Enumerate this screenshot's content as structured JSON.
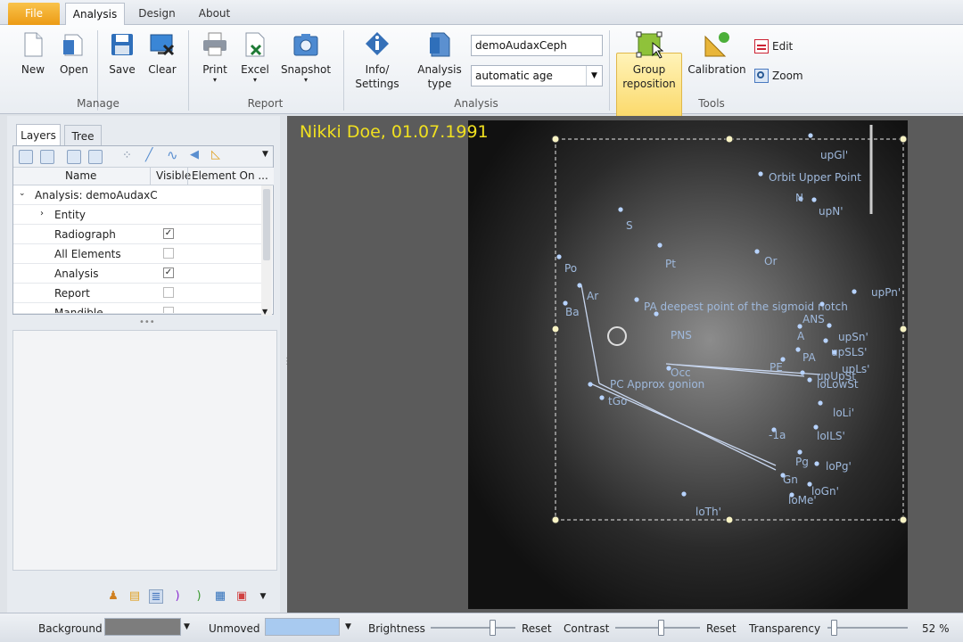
{
  "tabs": {
    "file": "File",
    "analysis": "Analysis",
    "design": "Design",
    "about": "About"
  },
  "ribbon": {
    "new": "New",
    "open": "Open",
    "save": "Save",
    "clear": "Clear",
    "print": "Print",
    "excel": "Excel",
    "snapshot": "Snapshot",
    "info_l1": "Info/",
    "info_l2": "Settings",
    "atype_l1": "Analysis",
    "atype_l2": "type",
    "analysis_name": "demoAudaxCeph",
    "age_mode": "automatic age",
    "group_l1": "Group",
    "group_l2": "reposition",
    "calibration": "Calibration",
    "edit": "Edit",
    "zoom": "Zoom",
    "groups": {
      "manage": "Manage",
      "report": "Report",
      "analysis": "Analysis",
      "tools": "Tools"
    }
  },
  "panel": {
    "tabs": {
      "layers": "Layers",
      "tree": "Tree"
    },
    "columns": {
      "name": "Name",
      "visible": "Visible",
      "element_on": "Element On ..."
    },
    "root": "Analysis: demoAudaxC",
    "rows": [
      {
        "label": "Entity",
        "checked": null
      },
      {
        "label": "Radiograph",
        "checked": true
      },
      {
        "label": "All Elements",
        "checked": false
      },
      {
        "label": "Analysis",
        "checked": true
      },
      {
        "label": "Report",
        "checked": false
      },
      {
        "label": "Mandible",
        "checked": false
      }
    ]
  },
  "canvas": {
    "patient": "Nikki Doe, 01.07.1991",
    "landmarks": [
      "upGl'",
      "Orbit Upper Point",
      "N",
      "upN'",
      "S",
      "Pt",
      "Or",
      "upPn'",
      "Po",
      "Ar",
      "Ba",
      "PA deepest point of the sigmoid notch",
      "ANS",
      "PNS",
      "A",
      "upSn'",
      "upSLS'",
      "PA",
      "upLs'",
      "Occ",
      "PE",
      "upUpSt",
      "loLowSt",
      "PC Approx gonion",
      "tGo",
      "loLi'",
      "-1a",
      "loILS'",
      "Pg",
      "loPg'",
      "Gn",
      "loGn'",
      "loMe'",
      "loTh'"
    ],
    "check_mark": "✓"
  },
  "status": {
    "background": "Background",
    "unmoved": "Unmoved",
    "brightness": "Brightness",
    "reset": "Reset",
    "contrast": "Contrast",
    "transparency": "Transparency",
    "zoom": "52 %",
    "brightness_level": 0.75,
    "contrast_level": 0.55,
    "transparency_level": 0.05
  }
}
